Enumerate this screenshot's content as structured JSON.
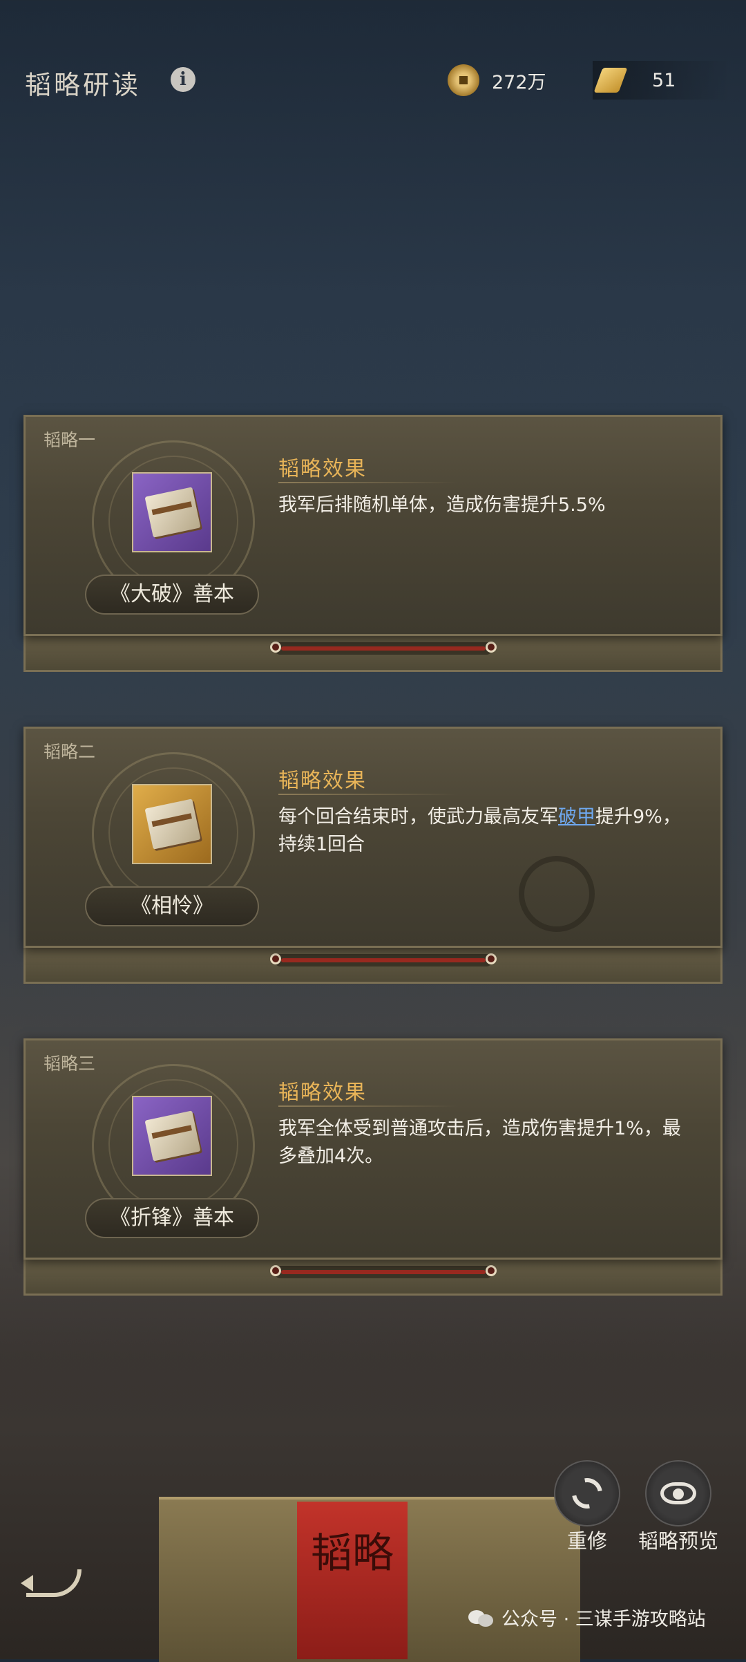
{
  "header": {
    "title": "韬略研读",
    "info_icon": "i",
    "coins": "272万",
    "scrolls": "51"
  },
  "cards": [
    {
      "label": "韬略一",
      "effect_title": "韬略效果",
      "effect_text": "我军后排随机单体，造成伤害提升5.5%",
      "item_name": "《大破》善本",
      "item_color": "#7a55b4"
    },
    {
      "label": "韬略二",
      "effect_title": "韬略效果",
      "effect_pre": "每个回合结束时，使武力最高友军",
      "effect_highlight": "破甲",
      "effect_post": "提升9%，持续1回合",
      "item_name": "《相怜》",
      "item_color": "#d09a3c"
    },
    {
      "label": "韬略三",
      "effect_title": "韬略效果",
      "effect_text": "我军全体受到普通攻击后，造成伤害提升1%，最多叠加4次。",
      "item_name": "《折锋》善本",
      "item_color": "#7a55b4"
    }
  ],
  "buttons": {
    "rebuild": "重修",
    "preview": "韬略预览"
  },
  "box_text": "韬略",
  "watermark": "公众号 · 三谋手游攻略站",
  "colors": {
    "accent_gold": "#e8b458",
    "highlight_blue": "#6fa9f0"
  }
}
